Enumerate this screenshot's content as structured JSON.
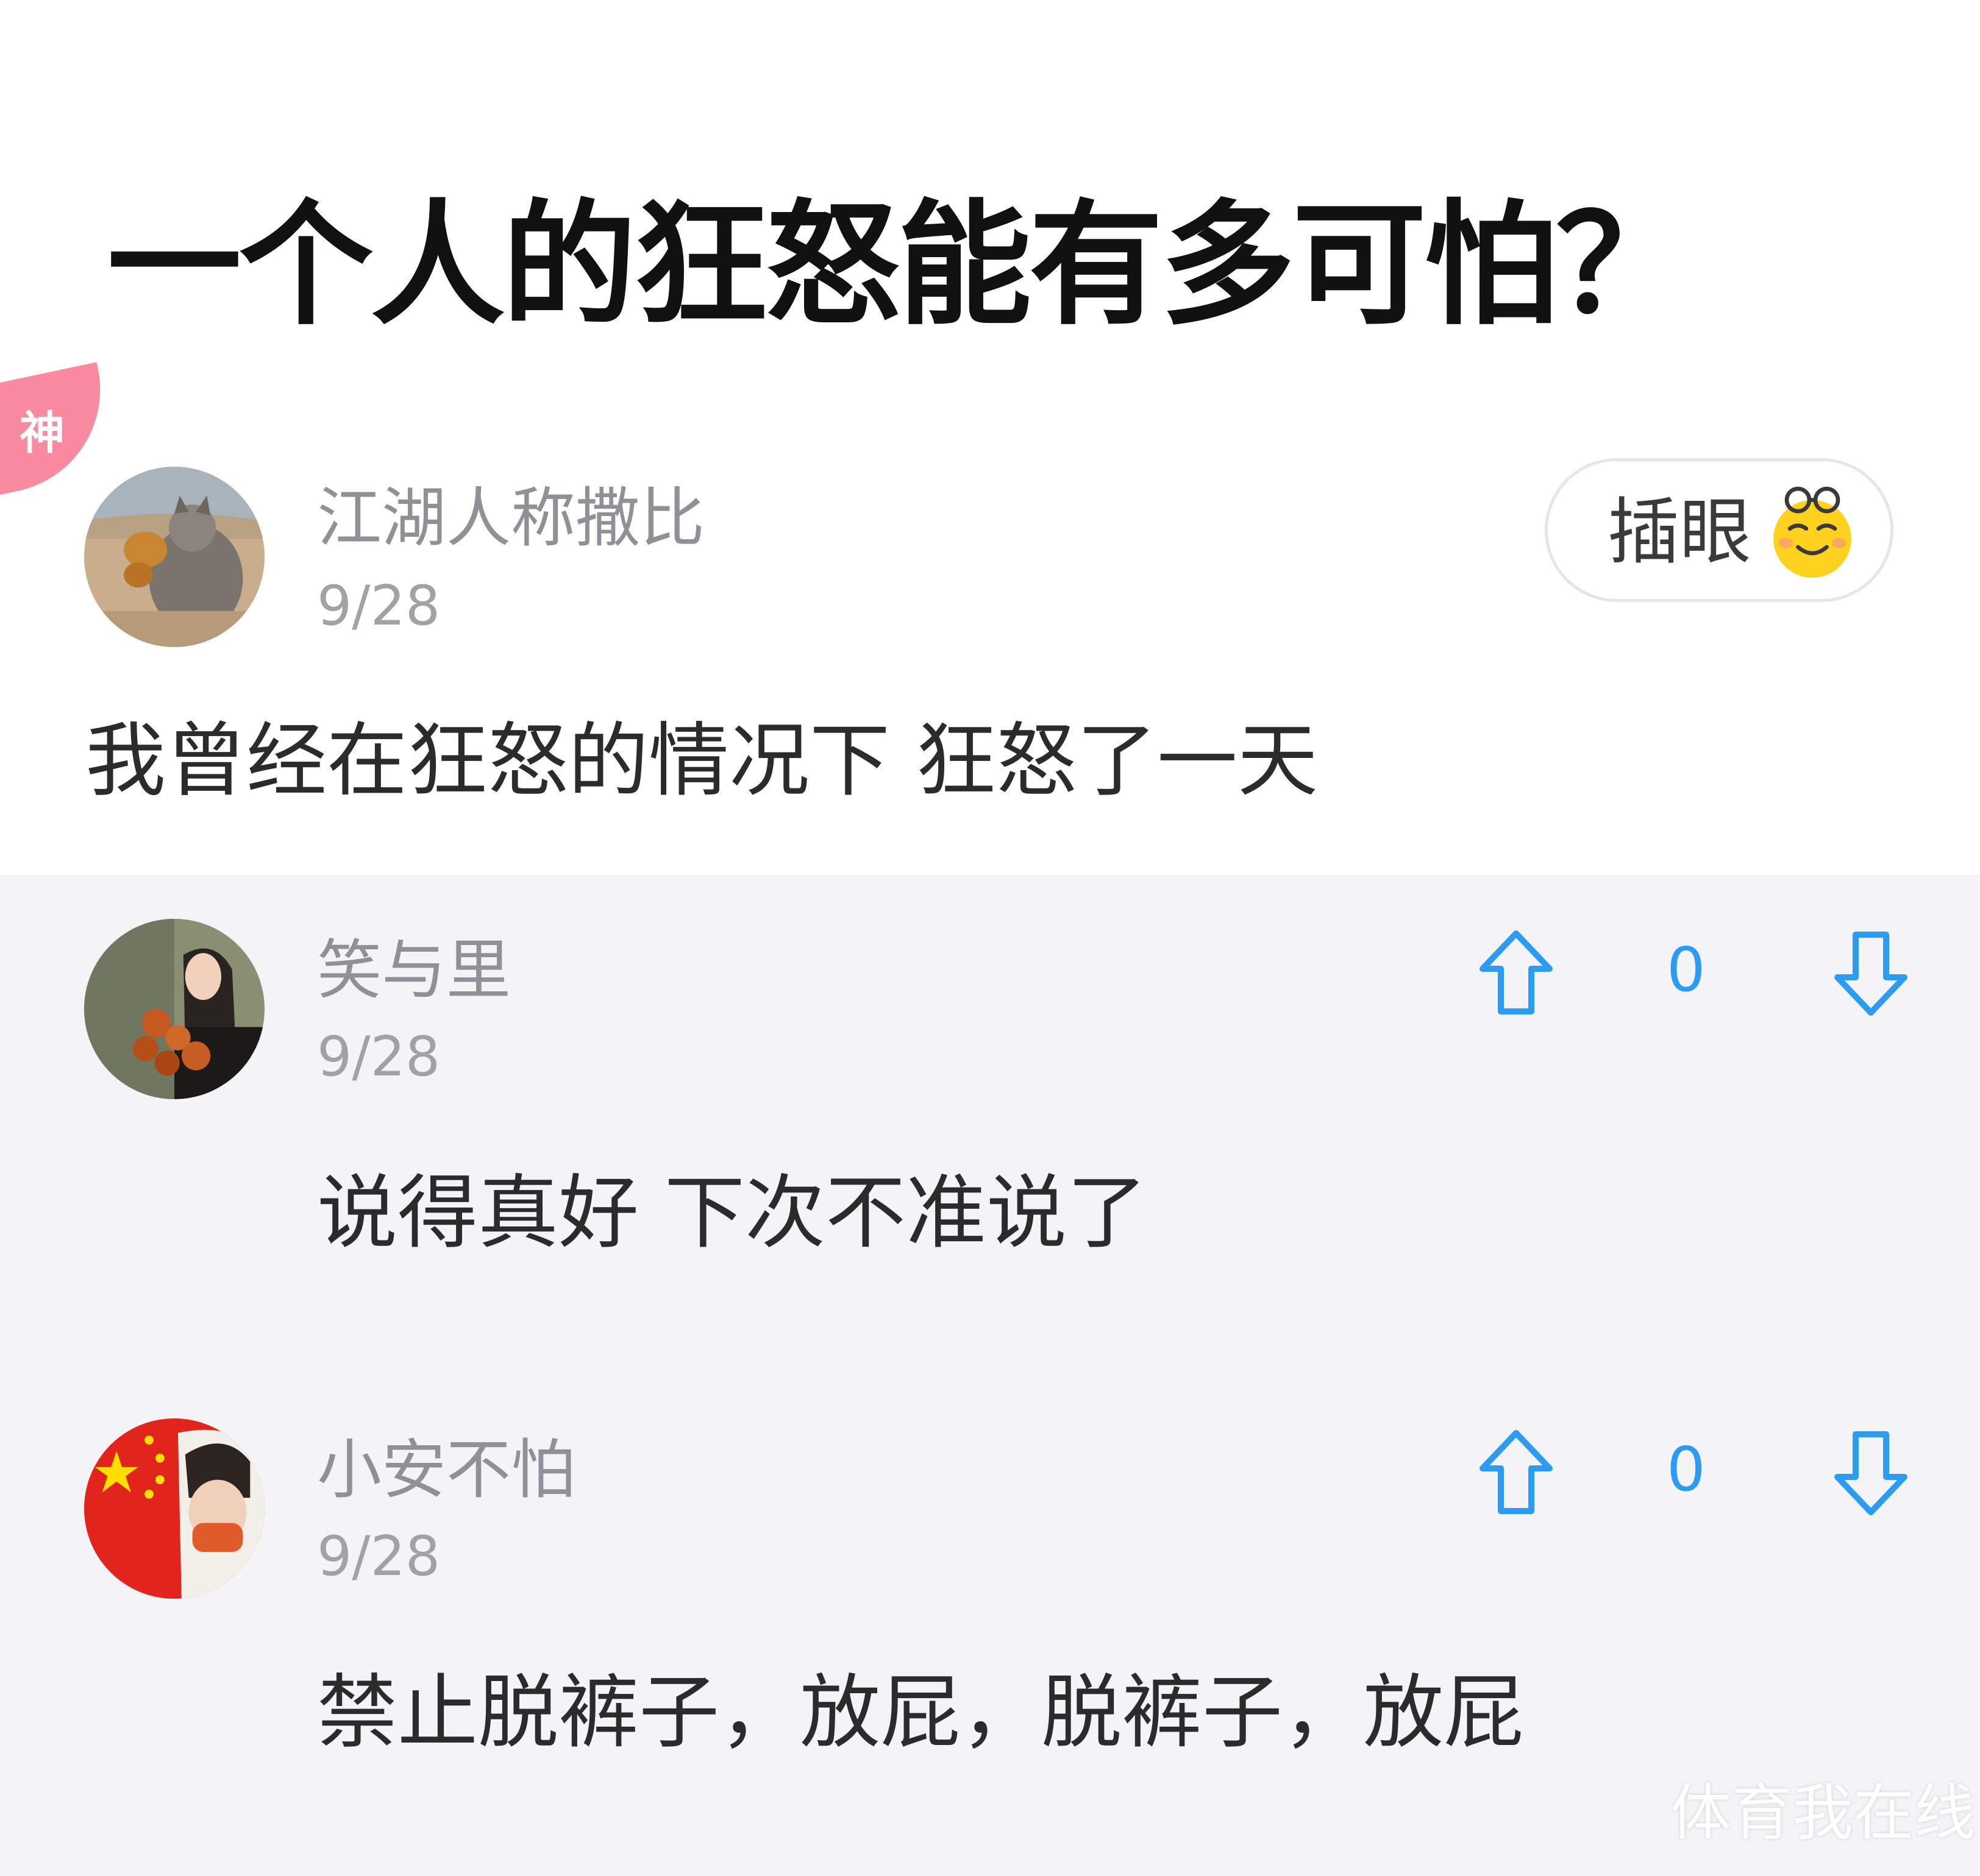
{
  "question": {
    "title": "一个人的狂怒能有多可怕？"
  },
  "top_comment": {
    "badge": "神",
    "username": "江湖人称撒比",
    "date": "9/28",
    "text": "我曾经在狂怒的情况下 狂怒了一天",
    "insert_button_label": "插眼",
    "insert_button_icon": "smiling-emoji-icon"
  },
  "replies": [
    {
      "username": "笑与里",
      "date": "9/28",
      "text": "说得真好 下次不准说了",
      "votes": "0"
    },
    {
      "username": "小安不怕",
      "date": "9/28",
      "text": "禁止脱裤子，放屁，脱裤子，放屁",
      "votes": "0"
    }
  ],
  "watermark": "体育我在线",
  "colors": {
    "accent_blue": "#2b9cf2",
    "badge_pink": "#f98aa0",
    "reply_bg": "#f4f4f6"
  }
}
